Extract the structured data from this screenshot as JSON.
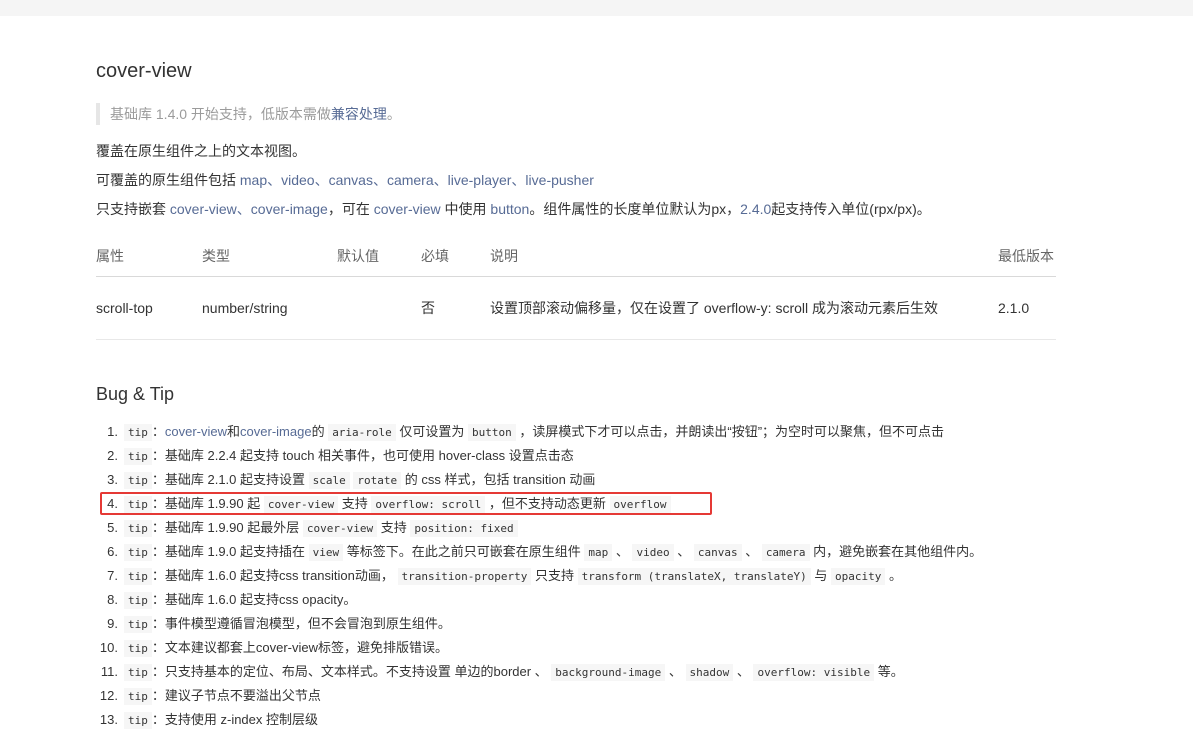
{
  "page": {
    "title": "cover-view",
    "note_prefix": "基础库 1.4.0 开始支持，低版本需做",
    "note_link": "兼容处理",
    "note_suffix": "。",
    "desc1": "覆盖在原生组件之上的文本视图。",
    "desc2_prefix": "可覆盖的原生组件包括 ",
    "desc2_links": "map、video、canvas、camera、live-player、live-pusher",
    "desc3_p1": "只支持嵌套 ",
    "desc3_link1": "cover-view、cover-image",
    "desc3_p2": "，可在 ",
    "desc3_link2": "cover-view",
    "desc3_p3": " 中使用 ",
    "desc3_link3": "button",
    "desc3_p4": "。组件属性的长度单位默认为px，",
    "desc3_link4": "2.4.0",
    "desc3_p5": "起支持传入单位(rpx/px)。"
  },
  "table": {
    "headers": [
      "属性",
      "类型",
      "默认值",
      "必填",
      "说明",
      "最低版本"
    ],
    "rows": [
      [
        "scroll-top",
        "number/string",
        "",
        "否",
        "设置顶部滚动偏移量，仅在设置了 overflow-y: scroll 成为滚动元素后生效",
        "2.1.0"
      ]
    ]
  },
  "section": {
    "title": "Bug & Tip"
  },
  "tips": [
    {
      "num": "1.",
      "segs": [
        {
          "c": "tip"
        },
        {
          "t": "："
        },
        {
          "l": "cover-view"
        },
        {
          "t": "和"
        },
        {
          "l": "cover-image"
        },
        {
          "t": "的 "
        },
        {
          "c": "aria-role"
        },
        {
          "t": " 仅可设置为 "
        },
        {
          "c": "button"
        },
        {
          "t": " ，读屏模式下才可以点击，并朗读出“按钮”；为空时可以聚焦，但不可点击"
        }
      ]
    },
    {
      "num": "2.",
      "segs": [
        {
          "c": "tip"
        },
        {
          "t": "：基础库 2.2.4 起支持 touch 相关事件，也可使用 hover-class 设置点击态"
        }
      ]
    },
    {
      "num": "3.",
      "segs": [
        {
          "c": "tip"
        },
        {
          "t": "：基础库 2.1.0 起支持设置 "
        },
        {
          "c": "scale"
        },
        {
          "t": " "
        },
        {
          "c": "rotate"
        },
        {
          "t": " 的 css 样式，包括 transition 动画"
        }
      ]
    },
    {
      "num": "4.",
      "segs": [
        {
          "c": "tip"
        },
        {
          "t": "：基础库 1.9.90 起 "
        },
        {
          "c": "cover-view"
        },
        {
          "t": " 支持 "
        },
        {
          "c": "overflow: scroll"
        },
        {
          "t": " ，但不支持动态更新 "
        },
        {
          "c": "overflow"
        }
      ]
    },
    {
      "num": "5.",
      "segs": [
        {
          "c": "tip"
        },
        {
          "t": "：基础库 1.9.90 起最外层 "
        },
        {
          "c": "cover-view"
        },
        {
          "t": " 支持 "
        },
        {
          "c": "position: fixed"
        }
      ]
    },
    {
      "num": "6.",
      "segs": [
        {
          "c": "tip"
        },
        {
          "t": "：基础库 1.9.0 起支持插在 "
        },
        {
          "c": "view"
        },
        {
          "t": " 等标签下。在此之前只可嵌套在原生组件 "
        },
        {
          "c": "map"
        },
        {
          "t": " 、 "
        },
        {
          "c": "video"
        },
        {
          "t": " 、 "
        },
        {
          "c": "canvas"
        },
        {
          "t": " 、 "
        },
        {
          "c": "camera"
        },
        {
          "t": " 内，避免嵌套在其他组件内。"
        }
      ]
    },
    {
      "num": "7.",
      "segs": [
        {
          "c": "tip"
        },
        {
          "t": "：基础库 1.6.0 起支持css transition动画， "
        },
        {
          "c": "transition-property"
        },
        {
          "t": " 只支持 "
        },
        {
          "c": "transform (translateX, translateY)"
        },
        {
          "t": " 与 "
        },
        {
          "c": "opacity"
        },
        {
          "t": " 。"
        }
      ]
    },
    {
      "num": "8.",
      "segs": [
        {
          "c": "tip"
        },
        {
          "t": "：基础库 1.6.0 起支持css opacity。"
        }
      ]
    },
    {
      "num": "9.",
      "segs": [
        {
          "c": "tip"
        },
        {
          "t": "：事件模型遵循冒泡模型，但不会冒泡到原生组件。"
        }
      ]
    },
    {
      "num": "10.",
      "segs": [
        {
          "c": "tip"
        },
        {
          "t": "：文本建议都套上cover-view标签，避免排版错误。"
        }
      ]
    },
    {
      "num": "11.",
      "segs": [
        {
          "c": "tip"
        },
        {
          "t": "：只支持基本的定位、布局、文本样式。不支持设置 单边的border 、 "
        },
        {
          "c": "background-image"
        },
        {
          "t": " 、 "
        },
        {
          "c": "shadow"
        },
        {
          "t": " 、 "
        },
        {
          "c": "overflow: visible"
        },
        {
          "t": " 等。"
        }
      ]
    },
    {
      "num": "12.",
      "segs": [
        {
          "c": "tip"
        },
        {
          "t": "：建议子节点不要溢出父节点"
        }
      ]
    },
    {
      "num": "13.",
      "segs": [
        {
          "c": "tip"
        },
        {
          "t": "：支持使用 z-index 控制层级"
        }
      ]
    }
  ]
}
